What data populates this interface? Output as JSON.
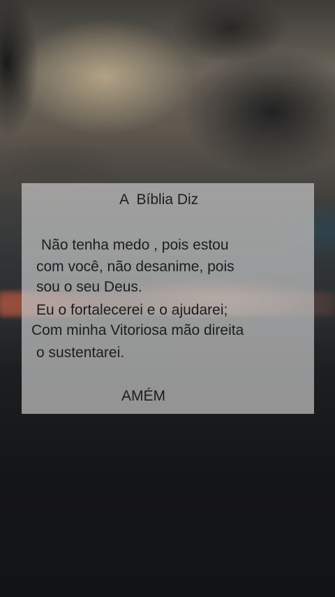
{
  "card": {
    "title": "A  Bíblia Diz",
    "lines": [
      "Não tenha medo , pois estou",
      "com você, não desanime, pois",
      "sou o seu Deus.",
      "Eu o fortalecerei e o ajudarei;",
      "Com minha Vitoriosa mão direita",
      "o sustentarei."
    ],
    "closing": "AMÉM"
  }
}
